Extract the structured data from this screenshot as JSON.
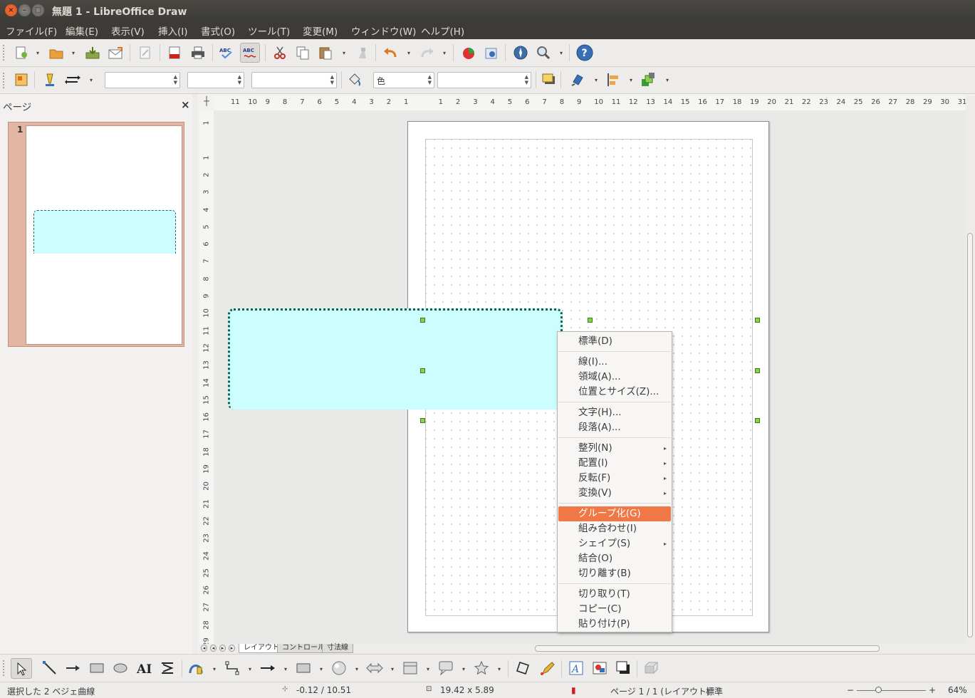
{
  "window": {
    "title": "無題 1 - LibreOffice Draw",
    "buttons": {
      "close": "×",
      "minimize": "–",
      "maximize": "□"
    }
  },
  "menubar": [
    "ファイル(F)",
    "編集(E)",
    "表示(V)",
    "挿入(I)",
    "書式(O)",
    "ツール(T)",
    "変更(M)",
    "ウィンドウ(W)",
    "ヘルプ(H)"
  ],
  "toolbar2": {
    "color_combo": "色"
  },
  "pages_pane": {
    "title": "ページ",
    "close": "×",
    "page_number": "1"
  },
  "rulers": {
    "corner": "┼",
    "horizontal": [
      "11",
      "10",
      "9",
      "8",
      "7",
      "6",
      "5",
      "4",
      "3",
      "2",
      "1",
      "",
      "1",
      "2",
      "3",
      "4",
      "5",
      "6",
      "7",
      "8",
      "9",
      "10",
      "11",
      "12",
      "13",
      "14",
      "15",
      "16",
      "17",
      "18",
      "19",
      "20",
      "21",
      "22",
      "23",
      "24",
      "25",
      "26",
      "27",
      "28",
      "29",
      "30",
      "31"
    ],
    "vertical": [
      "1",
      "",
      "1",
      "2",
      "3",
      "4",
      "5",
      "6",
      "7",
      "8",
      "9",
      "10",
      "11",
      "12",
      "13",
      "14",
      "15",
      "16",
      "17",
      "18",
      "19",
      "20",
      "21",
      "22",
      "23",
      "24",
      "25",
      "26",
      "27",
      "28",
      "29"
    ]
  },
  "context_menu": {
    "items": [
      {
        "label": "標準(D)"
      },
      {
        "sep": true
      },
      {
        "label": "線(I)..."
      },
      {
        "label": "領域(A)..."
      },
      {
        "label": "位置とサイズ(Z)..."
      },
      {
        "sep": true
      },
      {
        "label": "文字(H)..."
      },
      {
        "label": "段落(A)..."
      },
      {
        "sep": true
      },
      {
        "label": "整列(N)",
        "submenu": true
      },
      {
        "label": "配置(I)",
        "submenu": true
      },
      {
        "label": "反転(F)",
        "submenu": true
      },
      {
        "label": "変換(V)",
        "submenu": true
      },
      {
        "sep": true
      },
      {
        "label": "グループ化(G)",
        "highlighted": true
      },
      {
        "label": "組み合わせ(I)"
      },
      {
        "label": "シェイプ(S)",
        "submenu": true
      },
      {
        "label": "結合(O)"
      },
      {
        "label": "切り離す(B)"
      },
      {
        "sep": true
      },
      {
        "label": "切り取り(T)"
      },
      {
        "label": "コピー(C)"
      },
      {
        "label": "貼り付け(P)"
      }
    ],
    "submenu_glyph": "▸"
  },
  "layer_tabs": [
    "レイアウト",
    "コントロール",
    "寸法線"
  ],
  "status": {
    "selection": "選択した 2 ベジェ曲線",
    "position": "-0.12 / 10.51",
    "size": "19.42 x 5.89",
    "page": "ページ 1 / 1 (レイアウト)",
    "style": "標準",
    "zoom_minus": "−",
    "zoom_plus": "+",
    "zoom": "64%",
    "zoom_level": 0.32
  },
  "icons": {
    "toolbar1": [
      "new-icon",
      "open-icon",
      "save-icon",
      "email-icon",
      "edit-file-icon",
      "export-pdf-icon",
      "print-icon",
      "spellcheck-icon",
      "autospellcheck-icon",
      "cut-icon",
      "copy-icon",
      "paste-icon",
      "clone-formatting-icon",
      "undo-icon",
      "redo-icon",
      "chart-icon",
      "extrusion-icon",
      "navigator-icon",
      "zoom-icon",
      "help-icon"
    ],
    "drawbar": [
      "select-icon",
      "line-icon",
      "arrow-line-icon",
      "rectangle-icon",
      "ellipse-icon",
      "text-icon",
      "vertical-text-icon",
      "curve-icon",
      "connector-icon",
      "line-arrow-icon",
      "basic-shapes-icon",
      "symbol-shapes-icon",
      "block-arrows-icon",
      "flowchart-icon",
      "callout-icon",
      "stars-icon",
      "points-icon",
      "glue-points-icon",
      "fontwork-icon",
      "from-file-icon",
      "extrusion-toggle-icon",
      "shadow-icon"
    ]
  },
  "colors": {
    "accent": "#f07746",
    "shape_fill": "#ccfeff",
    "titlebar": "#3c3b37"
  }
}
